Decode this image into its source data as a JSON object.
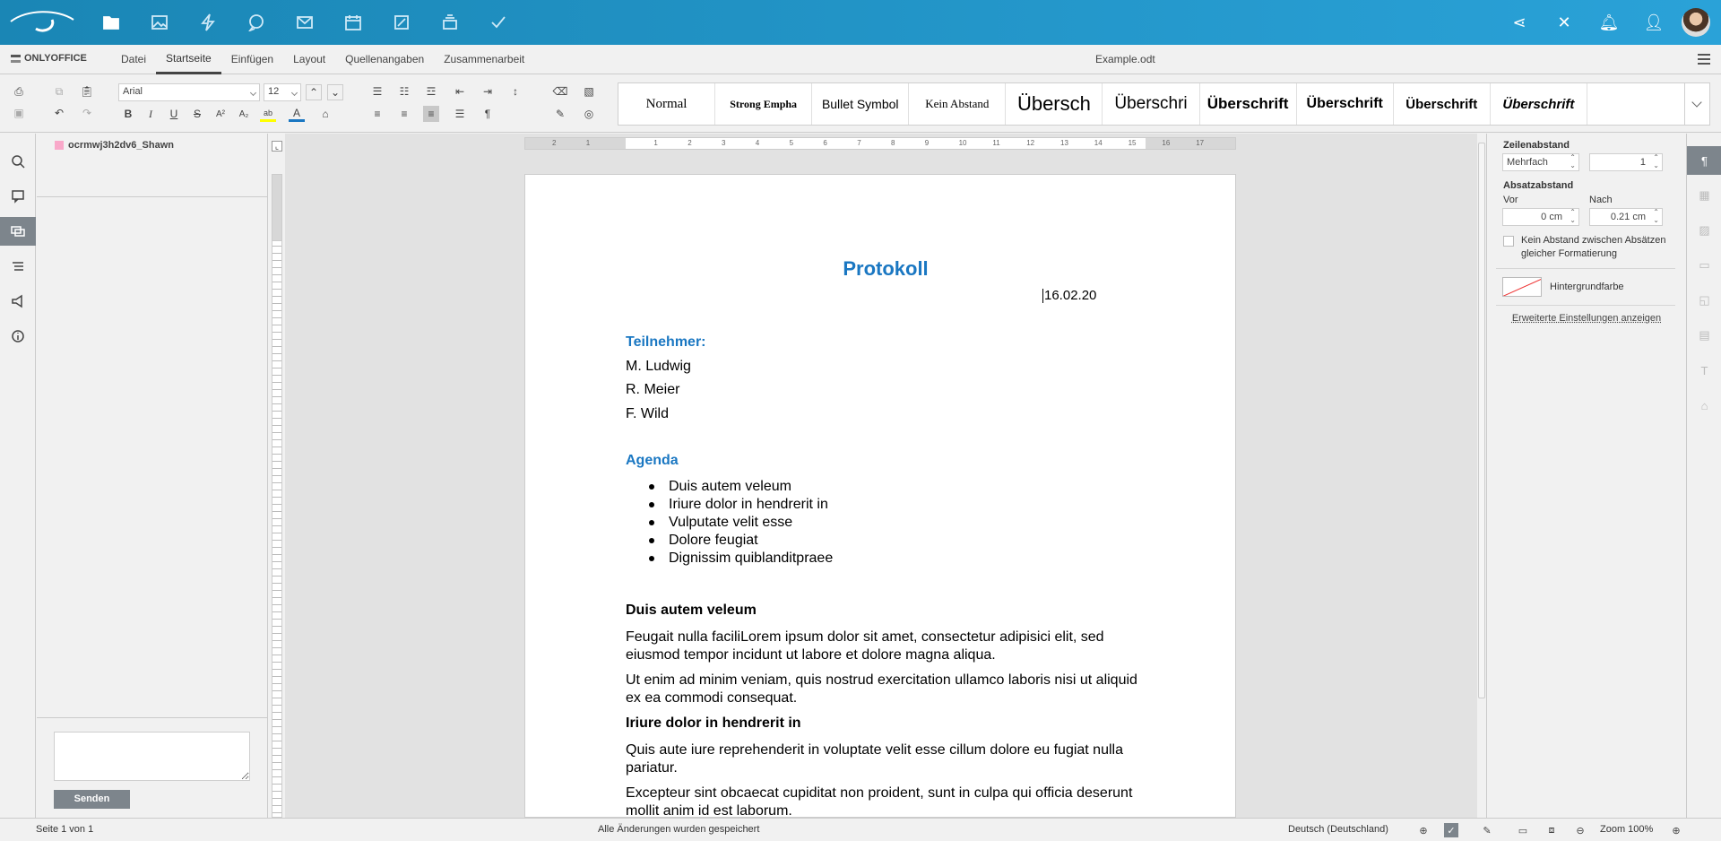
{
  "top_nav": {
    "icons": [
      "documents-icon",
      "photos-icon",
      "activity-icon",
      "talk-icon",
      "mail-icon",
      "calendar-icon",
      "notes-icon",
      "deck-icon",
      "tasks-icon"
    ],
    "right_icons": [
      "share-icon",
      "close-icon",
      "notifications-icon",
      "contacts-icon"
    ]
  },
  "menu": {
    "brand": "ONLYOFFICE",
    "tabs": [
      "Datei",
      "Startseite",
      "Einfügen",
      "Layout",
      "Quellenangaben",
      "Zusammenarbeit"
    ],
    "active_tab": "Startseite",
    "document_title": "Example.odt"
  },
  "toolbar": {
    "font_name": "Arial",
    "font_size": "12",
    "styles": [
      "Normal",
      "Strong Empha",
      "Bullet Symbol",
      "Kein Abstand",
      "Übersch",
      "Überschri",
      "Überschrift",
      "Überschrift",
      "Überschrift",
      "Überschrift",
      ""
    ]
  },
  "chat": {
    "user": "ocrmwj3h2dv6_Shawn",
    "send_label": "Senden",
    "user_color": "#f9a8c9"
  },
  "document": {
    "title": "Protokoll",
    "date": "16.02.20",
    "participants_heading": "Teilnehmer:",
    "participants": [
      "M. Ludwig",
      "R. Meier",
      "F. Wild"
    ],
    "agenda_heading": "Agenda",
    "agenda_items": [
      "Duis autem veleum",
      "Iriure dolor in hendrerit in",
      "Vulputate velit esse",
      "Dolore feugiat",
      "Dignissim quiblanditpraee"
    ],
    "sections": [
      {
        "heading": "Duis autem veleum",
        "paragraphs": [
          "Feugait nulla faciliLorem ipsum dolor sit amet, consectetur adipisici elit, sed eiusmod tempor incidunt ut labore et dolore magna aliqua.",
          "Ut enim ad minim veniam, quis nostrud exercitation ullamco laboris nisi ut aliquid ex ea commodi consequat."
        ]
      },
      {
        "heading": "Iriure dolor in hendrerit in",
        "paragraphs": [
          "Quis aute iure reprehenderit in voluptate velit esse cillum dolore eu fugiat nulla pariatur.",
          "Excepteur sint obcaecat cupiditat non proident, sunt in culpa qui officia deserunt mollit anim id est laborum."
        ]
      }
    ],
    "accent_color": "#1a77c2"
  },
  "ruler": {
    "labels": [
      "2",
      "1",
      "",
      "1",
      "2",
      "3",
      "4",
      "5",
      "6",
      "7",
      "8",
      "9",
      "10",
      "11",
      "12",
      "13",
      "14",
      "15",
      "16",
      "17"
    ]
  },
  "paragraph_settings": {
    "line_spacing_label": "Zeilenabstand",
    "line_spacing_mode": "Mehrfach",
    "line_spacing_value": "1",
    "paragraph_spacing_label": "Absatzabstand",
    "before_label": "Vor",
    "before_value": "0 cm",
    "after_label": "Nach",
    "after_value": "0.21 cm",
    "no_spacing_label": "Kein Abstand zwischen Absätzen gleicher Formatierung",
    "background_label": "Hintergrundfarbe",
    "advanced_link": "Erweiterte Einstellungen anzeigen"
  },
  "status": {
    "page": "Seite 1 von 1",
    "save_state": "Alle Änderungen wurden gespeichert",
    "language": "Deutsch (Deutschland)",
    "zoom": "Zoom 100%"
  }
}
